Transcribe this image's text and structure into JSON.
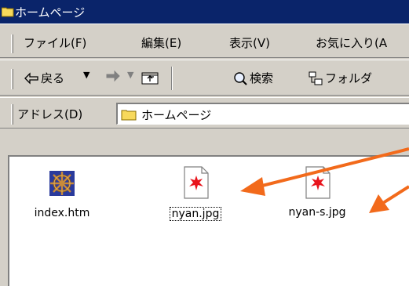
{
  "window": {
    "title": "ホームページ"
  },
  "menubar": {
    "items": [
      "ファイル(F)",
      "編集(E)",
      "表示(V)",
      "お気に入り(A"
    ]
  },
  "toolbar": {
    "back_label": "戻る",
    "search_label": "検索",
    "folders_label": "フォルダ"
  },
  "address": {
    "label": "アドレス(D)",
    "value": "ホームページ"
  },
  "files": [
    {
      "name": "index.htm",
      "icon": "ship-wheel-icon"
    },
    {
      "name": "nyan.jpg",
      "icon": "image-file-icon",
      "selected": true
    },
    {
      "name": "nyan-s.jpg",
      "icon": "image-file-icon"
    }
  ],
  "colors": {
    "titlebar": "#0a246a",
    "chrome": "#d4d0c8",
    "annotation_arrow": "#f26a1b"
  }
}
